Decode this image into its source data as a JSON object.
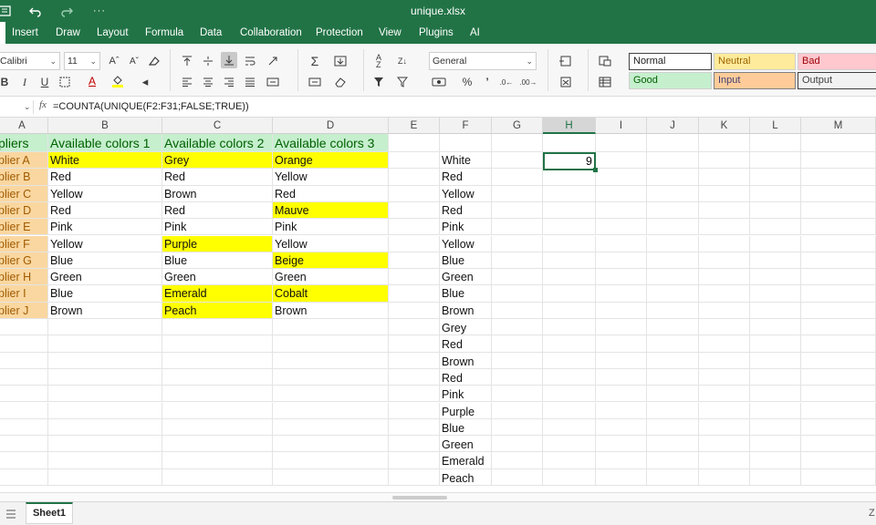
{
  "window": {
    "title": "unique.xlsx",
    "icons": [
      "app-menu-icon",
      "undo-icon",
      "redo-icon",
      "more-icon"
    ],
    "more_label": "···"
  },
  "menu": {
    "tabs": [
      "Insert",
      "Draw",
      "Layout",
      "Formula",
      "Data",
      "Collaboration",
      "Protection",
      "View",
      "Plugins",
      "AI"
    ]
  },
  "ribbon": {
    "font_name": "Calibri",
    "font_size": "11",
    "number_format": "General",
    "percent": "%",
    "comma": "’"
  },
  "styles": [
    {
      "label": "Normal",
      "bg": "#ffffff",
      "color": "#222222",
      "border": "#444444"
    },
    {
      "label": "Neutral",
      "bg": "#ffeb9c",
      "color": "#9c6500",
      "border": "#cfcfcf"
    },
    {
      "label": "Bad",
      "bg": "#ffc7ce",
      "color": "#9c0006",
      "border": "#cfcfcf"
    },
    {
      "label": "Good",
      "bg": "#c6efce",
      "color": "#006100",
      "border": "#cfcfcf"
    },
    {
      "label": "Input",
      "bg": "#ffcc99",
      "color": "#3f3f76",
      "border": "#7f7f7f"
    },
    {
      "label": "Output",
      "bg": "#f2f2f2",
      "color": "#3f3f3f",
      "border": "#3f3f3f"
    }
  ],
  "formula_bar": {
    "name_box": "",
    "fx": "fx",
    "formula": "=COUNTA(UNIQUE(F2:F31;FALSE;TRUE))"
  },
  "columns": [
    "A",
    "B",
    "C",
    "D",
    "E",
    "F",
    "G",
    "H",
    "I",
    "J",
    "K",
    "L",
    "M"
  ],
  "active_column": "H",
  "colors": {
    "accent": "#217346",
    "header_fill": "#c6efce",
    "header_text": "#006100",
    "highlight_yellow": "#ffff00",
    "supplier_fill": "#fad7a0",
    "supplier_text": "#a05a00"
  },
  "table": {
    "headers": [
      "pliers",
      "Available colors 1",
      "Available colors 2",
      "Available colors 3"
    ],
    "rows": [
      [
        "plier A",
        "White",
        "Grey",
        "Orange"
      ],
      [
        "plier B",
        "Red",
        "Red",
        "Yellow"
      ],
      [
        "plier C",
        "Yellow",
        "Brown",
        "Red"
      ],
      [
        "plier D",
        "Red",
        "Red",
        "Mauve"
      ],
      [
        "plier E",
        "Pink",
        "Pink",
        "Pink"
      ],
      [
        "plier F",
        "Yellow",
        "Purple",
        "Yellow"
      ],
      [
        "plier G",
        "Blue",
        "Blue",
        "Beige"
      ],
      [
        "plier H",
        "Green",
        "Green",
        "Green"
      ],
      [
        "plier I",
        "Blue",
        "Emerald",
        "Cobalt"
      ],
      [
        "plier J",
        "Brown",
        "Peach",
        "Brown"
      ]
    ],
    "highlights": [
      [
        0,
        1
      ],
      [
        0,
        2
      ],
      [
        0,
        3
      ],
      [
        3,
        3
      ],
      [
        5,
        2
      ],
      [
        6,
        3
      ],
      [
        8,
        2
      ],
      [
        8,
        3
      ],
      [
        9,
        2
      ]
    ]
  },
  "column_f": [
    "White",
    "Red",
    "Yellow",
    "Red",
    "Pink",
    "Yellow",
    "Blue",
    "Green",
    "Blue",
    "Brown",
    "Grey",
    "Red",
    "Brown",
    "Red",
    "Pink",
    "Purple",
    "Blue",
    "Green",
    "Emerald",
    "Peach"
  ],
  "result": {
    "value": "9"
  },
  "sheets": [
    "Sheet1"
  ],
  "statusbar_right": "Z"
}
